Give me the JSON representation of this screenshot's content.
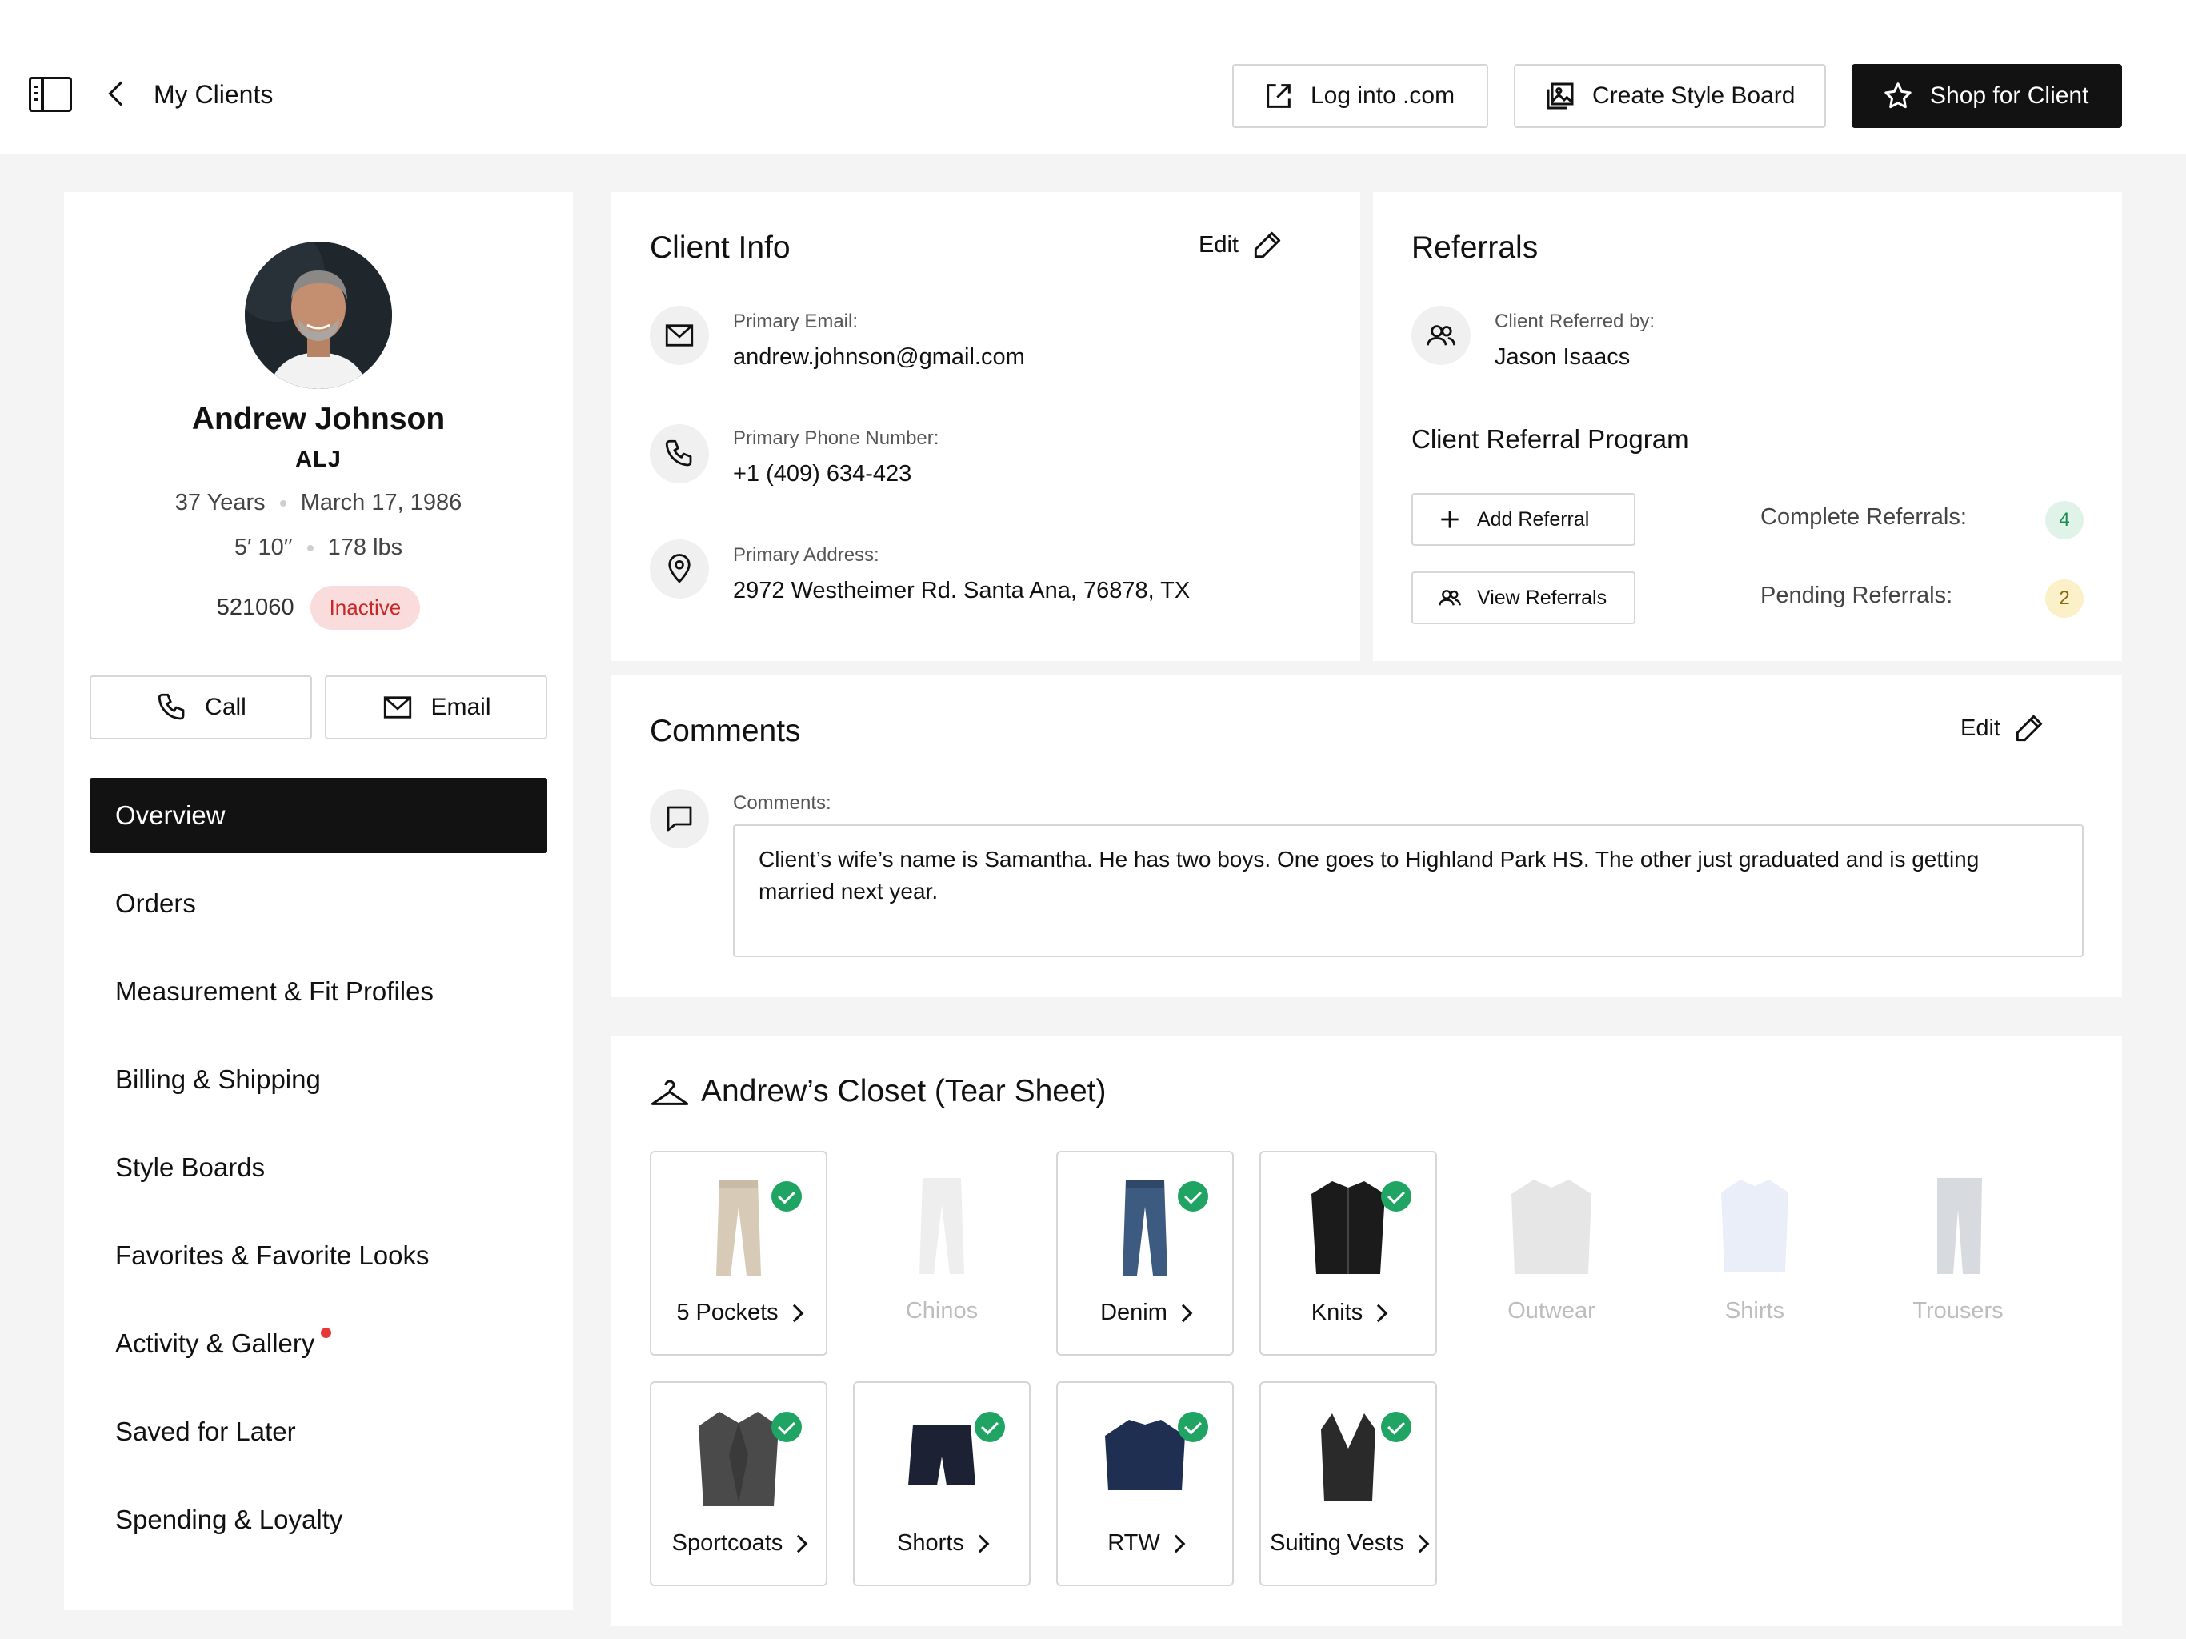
{
  "header": {
    "breadcrumb": "My Clients",
    "buttons": {
      "log_into": "Log into .com",
      "create_style_board": "Create Style Board",
      "shop_for_client": "Shop for Client"
    }
  },
  "profile": {
    "name": "Andrew Johnson",
    "initials": "ALJ",
    "age": "37 Years",
    "birthdate": "March 17, 1986",
    "height": "5′ 10′′",
    "weight": "178 lbs",
    "client_id": "521060",
    "status": "Inactive",
    "call_label": "Call",
    "email_label": "Email"
  },
  "nav": {
    "items": [
      {
        "label": "Overview"
      },
      {
        "label": "Orders"
      },
      {
        "label": "Measurement & Fit Profiles"
      },
      {
        "label": "Billing & Shipping"
      },
      {
        "label": "Style Boards"
      },
      {
        "label": "Favorites & Favorite Looks"
      },
      {
        "label": "Activity & Gallery"
      },
      {
        "label": "Saved for Later"
      },
      {
        "label": "Spending & Loyalty"
      }
    ]
  },
  "client_info": {
    "title": "Client Info",
    "edit_label": "Edit",
    "email_label": "Primary Email:",
    "email_value": "andrew.johnson@gmail.com",
    "phone_label": "Primary Phone Number:",
    "phone_value": "+1 (409) 634-423",
    "address_label": "Primary Address:",
    "address_value": "2972 Westheimer Rd. Santa Ana, 76878, TX"
  },
  "referrals": {
    "title": "Referrals",
    "referred_by_label": "Client Referred by:",
    "referred_by_value": "Jason Isaacs",
    "program_title": "Client Referral Program",
    "add_referral": "Add Referral",
    "view_referrals": "View Referrals",
    "complete_label": "Complete Referrals:",
    "complete_count": "4",
    "pending_label": "Pending Referrals:",
    "pending_count": "2"
  },
  "comments": {
    "title": "Comments",
    "edit_label": "Edit",
    "field_label": "Comments:",
    "text": "Client’s wife’s name is Samantha. He has two boys. One goes to Highland Park HS. The other just graduated and is getting married next year."
  },
  "closet": {
    "title": "Andrew’s Closet (Tear Sheet)",
    "items": [
      {
        "label": "5 Pockets"
      },
      {
        "label": "Chinos"
      },
      {
        "label": "Denim"
      },
      {
        "label": "Knits"
      },
      {
        "label": "Outwear"
      },
      {
        "label": "Shirts"
      },
      {
        "label": "Trousers"
      },
      {
        "label": "Sportcoats"
      },
      {
        "label": "Shorts"
      },
      {
        "label": "RTW"
      },
      {
        "label": "Suiting Vests"
      }
    ]
  },
  "colors": {
    "dark": "#121212",
    "success": "#20a464",
    "inactive_bg": "#fbdcdc",
    "inactive_text": "#c62828",
    "complete_bg": "#dff3e8",
    "pending_bg": "#fbf0c8"
  }
}
